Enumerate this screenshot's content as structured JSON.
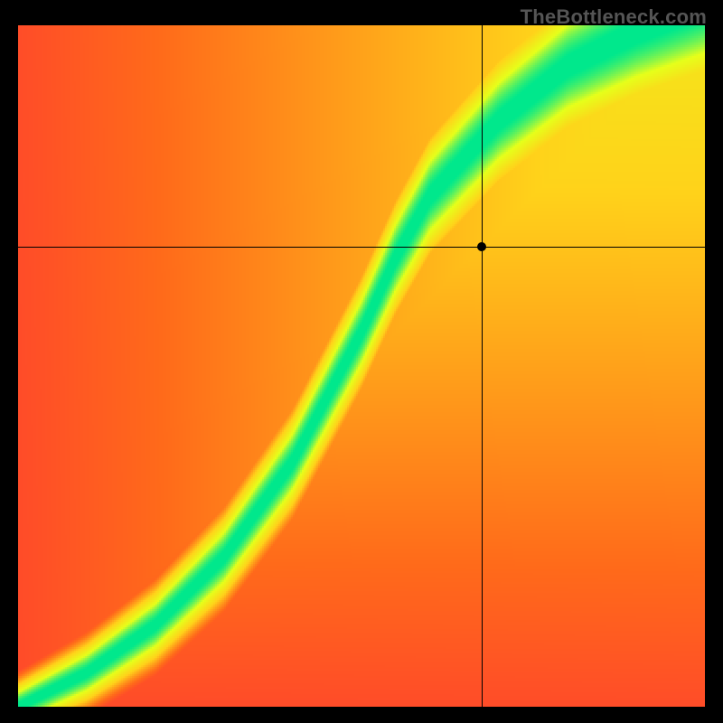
{
  "watermark": "TheBottleneck.com",
  "chart_data": {
    "type": "heatmap",
    "title": "",
    "xlabel": "",
    "ylabel": "",
    "xlim": [
      0,
      1
    ],
    "ylim": [
      0,
      1
    ],
    "colorscale": [
      {
        "t": 0.0,
        "color": "#ff1a40"
      },
      {
        "t": 0.25,
        "color": "#ff6a1a"
      },
      {
        "t": 0.5,
        "color": "#ffd21a"
      },
      {
        "t": 0.75,
        "color": "#e6ff1a"
      },
      {
        "t": 1.0,
        "color": "#00e88c"
      }
    ],
    "ridge": {
      "description": "Locus of maximum (green) values. Piecewise curve y(x) with y superlinear for small x and near-linear for large x.",
      "points": [
        {
          "x": 0.0,
          "y": 0.0
        },
        {
          "x": 0.1,
          "y": 0.05
        },
        {
          "x": 0.2,
          "y": 0.12
        },
        {
          "x": 0.3,
          "y": 0.22
        },
        {
          "x": 0.4,
          "y": 0.36
        },
        {
          "x": 0.5,
          "y": 0.55
        },
        {
          "x": 0.55,
          "y": 0.66
        },
        {
          "x": 0.6,
          "y": 0.75
        },
        {
          "x": 0.7,
          "y": 0.86
        },
        {
          "x": 0.8,
          "y": 0.94
        },
        {
          "x": 0.9,
          "y": 0.99
        },
        {
          "x": 1.0,
          "y": 1.03
        }
      ],
      "width_sigma": 0.045
    },
    "crosshair": {
      "x": 0.675,
      "y": 0.675
    },
    "marker": {
      "x": 0.675,
      "y": 0.675
    }
  }
}
